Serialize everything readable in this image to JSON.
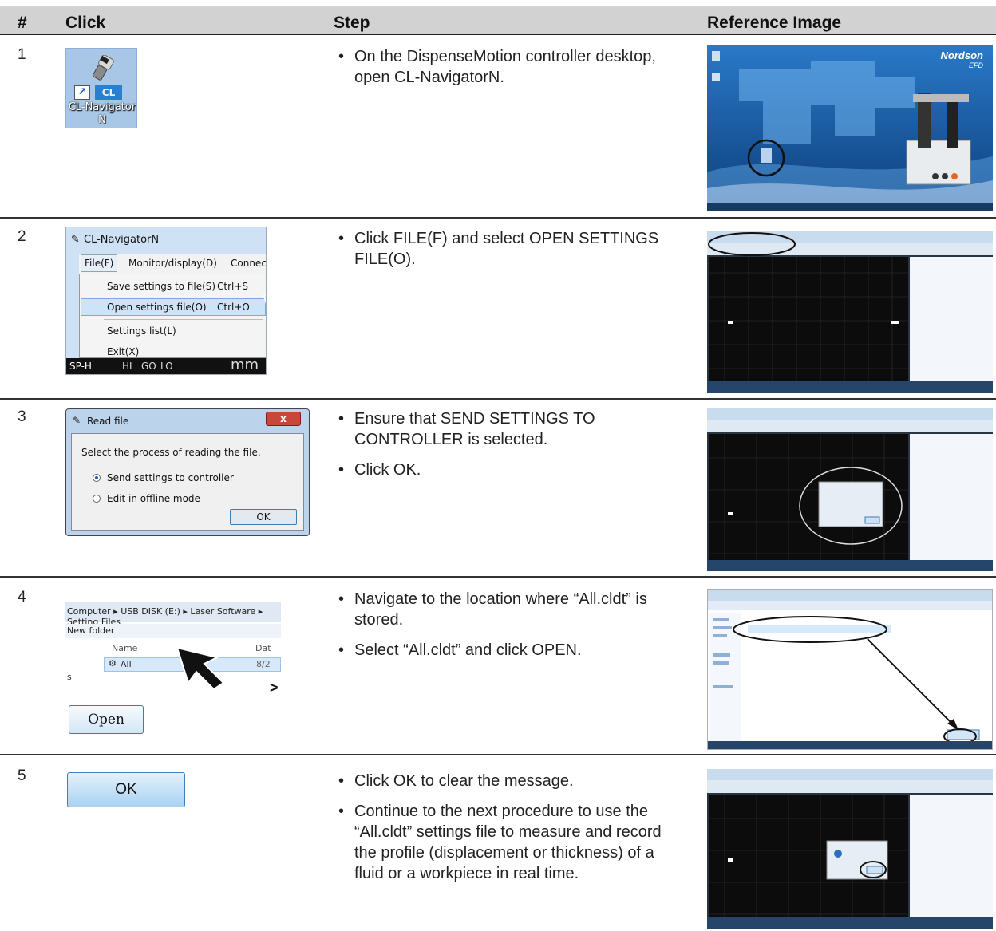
{
  "table": {
    "headers": [
      "#",
      "Click",
      "Step",
      "Reference Image"
    ],
    "rows": [
      {
        "num": "1",
        "bullets": [
          "On the DispenseMotion controller desktop, open CL-NavigatorN."
        ],
        "click": {
          "shortcut_glyph": "↗",
          "badge": "CL",
          "label_line1": "CL-Navigator",
          "label_line2": "N"
        },
        "ref": {
          "logo": "Nordson",
          "logo_sub": "EFD"
        }
      },
      {
        "num": "2",
        "bullets": [
          "Click FILE(F) and select OPEN SETTINGS FILE(O)."
        ],
        "click": {
          "window_title": "CL-NavigatorN",
          "menubar": [
            "File(F)",
            "Monitor/display(D)",
            "Connect"
          ],
          "items": [
            {
              "label": "Save settings to file(S)",
              "shortcut": "Ctrl+S"
            },
            {
              "label": "Open settings file(O)",
              "shortcut": "Ctrl+O"
            },
            {
              "label": "Settings list(L)",
              "shortcut": ""
            },
            {
              "label": "Exit(X)",
              "shortcut": ""
            }
          ],
          "status": [
            "SP-H",
            "HI",
            "GO",
            "LO",
            "mm"
          ]
        }
      },
      {
        "num": "3",
        "bullets": [
          "Ensure that SEND SETTINGS TO CONTROLLER is selected.",
          "Click OK."
        ],
        "click": {
          "title": "Read file",
          "close": "x",
          "question": "Select the process of reading the file.",
          "options": [
            "Send settings to controller",
            "Edit in offline mode"
          ],
          "ok": "OK"
        }
      },
      {
        "num": "4",
        "bullets": [
          "Navigate to the location where “All.cldt” is stored.",
          "Select “All.cldt” and click OPEN."
        ],
        "click": {
          "path": "Computer ▸ USB DISK (E:) ▸ Laser Software ▸ Setting Files",
          "new_folder": "New folder",
          "col_name": "Name",
          "col_date": "Dat",
          "file": "All",
          "file_date": "8/2",
          "side_label": "s",
          "gt": ">",
          "open": "Open"
        }
      },
      {
        "num": "5",
        "bullets": [
          "Click OK to clear the message.",
          "Continue to the next procedure to use the “All.cldt” settings file to measure and record the profile (displacement or thickness) of a fluid or a workpiece in real time."
        ],
        "click": {
          "ok": "OK"
        }
      }
    ]
  },
  "colors": {
    "header_bg": "#d2d2d2",
    "rule": "#333333",
    "accent_blue": "#3f7fbf"
  },
  "icons": [
    "shortcut-arrow-icon",
    "lens-icon",
    "pointer-cursor-icon",
    "radio-icon",
    "folder-icon"
  ]
}
